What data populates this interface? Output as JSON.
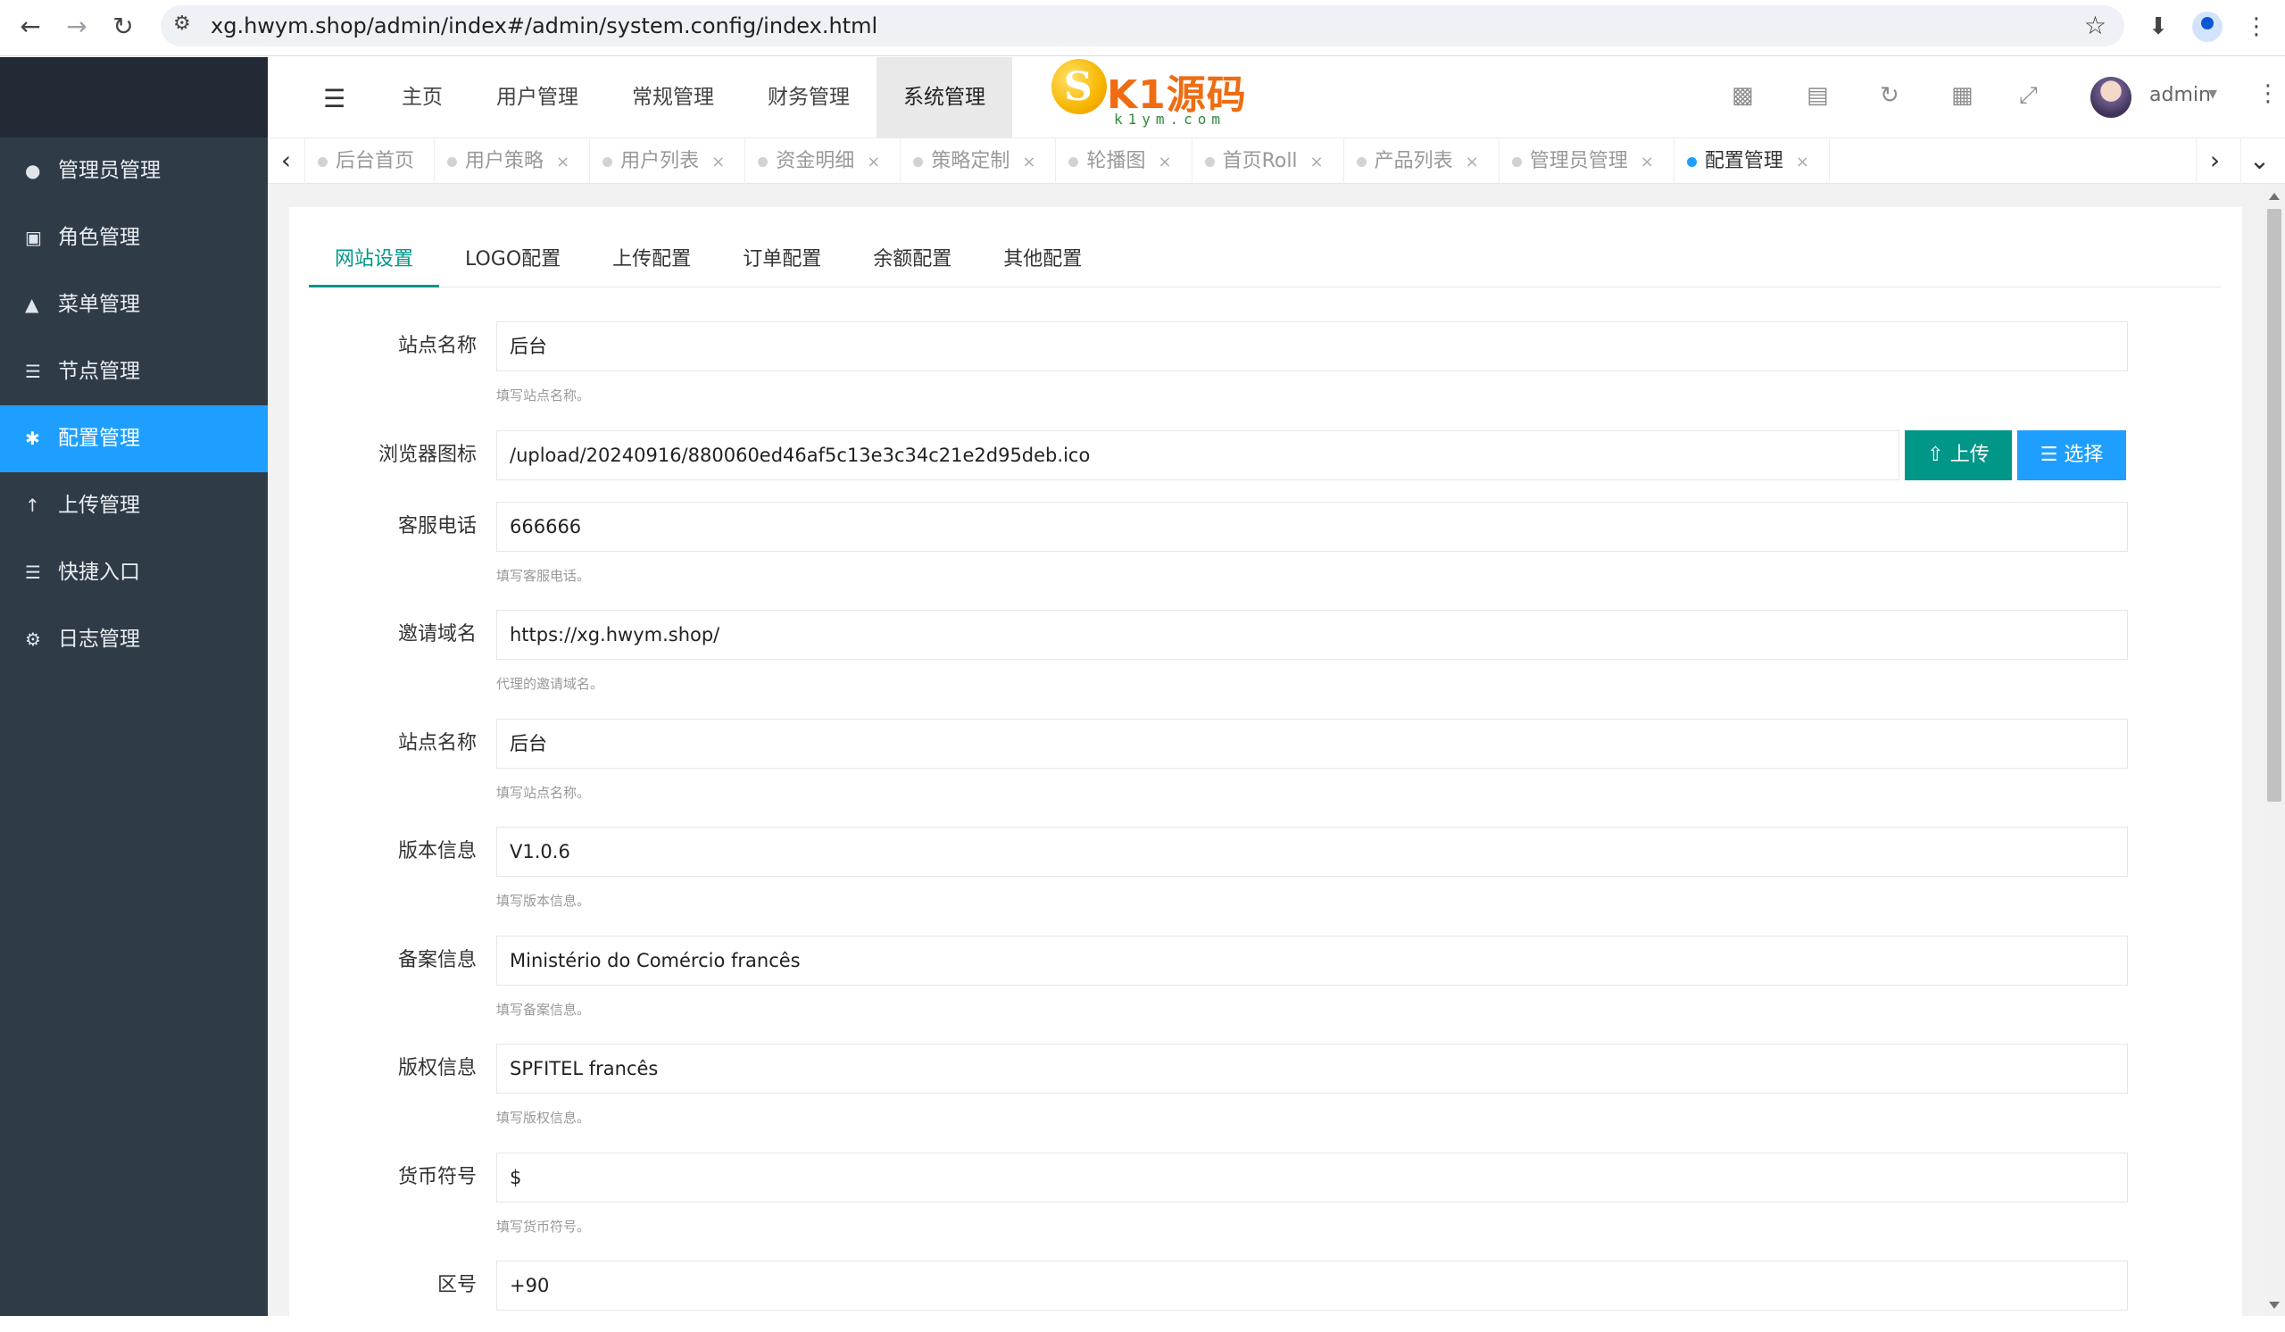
{
  "browser": {
    "url": "xg.hwym.shop/admin/index#/admin/system.config/index.html"
  },
  "sidebar": {
    "items": [
      {
        "label": "管理员管理",
        "icon": "user-icon"
      },
      {
        "label": "角色管理",
        "icon": "badge-icon"
      },
      {
        "label": "菜单管理",
        "icon": "tree-icon"
      },
      {
        "label": "节点管理",
        "icon": "list-icon"
      },
      {
        "label": "配置管理",
        "icon": "asterisk-icon",
        "active": true
      },
      {
        "label": "上传管理",
        "icon": "arrow-up-icon"
      },
      {
        "label": "快捷入口",
        "icon": "list-icon"
      },
      {
        "label": "日志管理",
        "icon": "gear-icon"
      }
    ]
  },
  "header": {
    "nav": [
      "主页",
      "用户管理",
      "常规管理",
      "财务管理",
      "系统管理"
    ],
    "active_nav": "系统管理",
    "brand_main": "K1源码",
    "brand_sub": "k1ym.com",
    "user": "admin"
  },
  "tabs": [
    {
      "label": "后台首页",
      "closable": false
    },
    {
      "label": "用户策略",
      "closable": true
    },
    {
      "label": "用户列表",
      "closable": true
    },
    {
      "label": "资金明细",
      "closable": true
    },
    {
      "label": "策略定制",
      "closable": true
    },
    {
      "label": "轮播图",
      "closable": true
    },
    {
      "label": "首页Roll",
      "closable": true
    },
    {
      "label": "产品列表",
      "closable": true
    },
    {
      "label": "管理员管理",
      "closable": true
    },
    {
      "label": "配置管理",
      "closable": true,
      "active": true
    }
  ],
  "config_tabs": [
    "网站设置",
    "LOGO配置",
    "上传配置",
    "订单配置",
    "余额配置",
    "其他配置"
  ],
  "form": {
    "site_name_1": {
      "label": "站点名称",
      "value": "后台",
      "hint": "填写站点名称。"
    },
    "favicon": {
      "label": "浏览器图标",
      "value": "/upload/20240916/880060ed46af5c13e3c34c21e2d95deb.ico",
      "upload_label": "上传",
      "select_label": "选择"
    },
    "service_phone": {
      "label": "客服电话",
      "value": "666666",
      "hint": "填写客服电话。"
    },
    "invite_domain": {
      "label": "邀请域名",
      "value": "https://xg.hwym.shop/",
      "hint": "代理的邀请域名。"
    },
    "site_name_2": {
      "label": "站点名称",
      "value": "后台",
      "hint": "填写站点名称。"
    },
    "version": {
      "label": "版本信息",
      "value": "V1.0.6",
      "hint": "填写版本信息。"
    },
    "record": {
      "label": "备案信息",
      "value": "Ministério do Comércio francês",
      "hint": "填写备案信息。"
    },
    "copyright": {
      "label": "版权信息",
      "value": "SPFITEL francês",
      "hint": "填写版权信息。"
    },
    "currency": {
      "label": "货币符号",
      "value": "$",
      "hint": "填写货币符号。"
    },
    "area_code": {
      "label": "区号",
      "value": "+90"
    }
  }
}
